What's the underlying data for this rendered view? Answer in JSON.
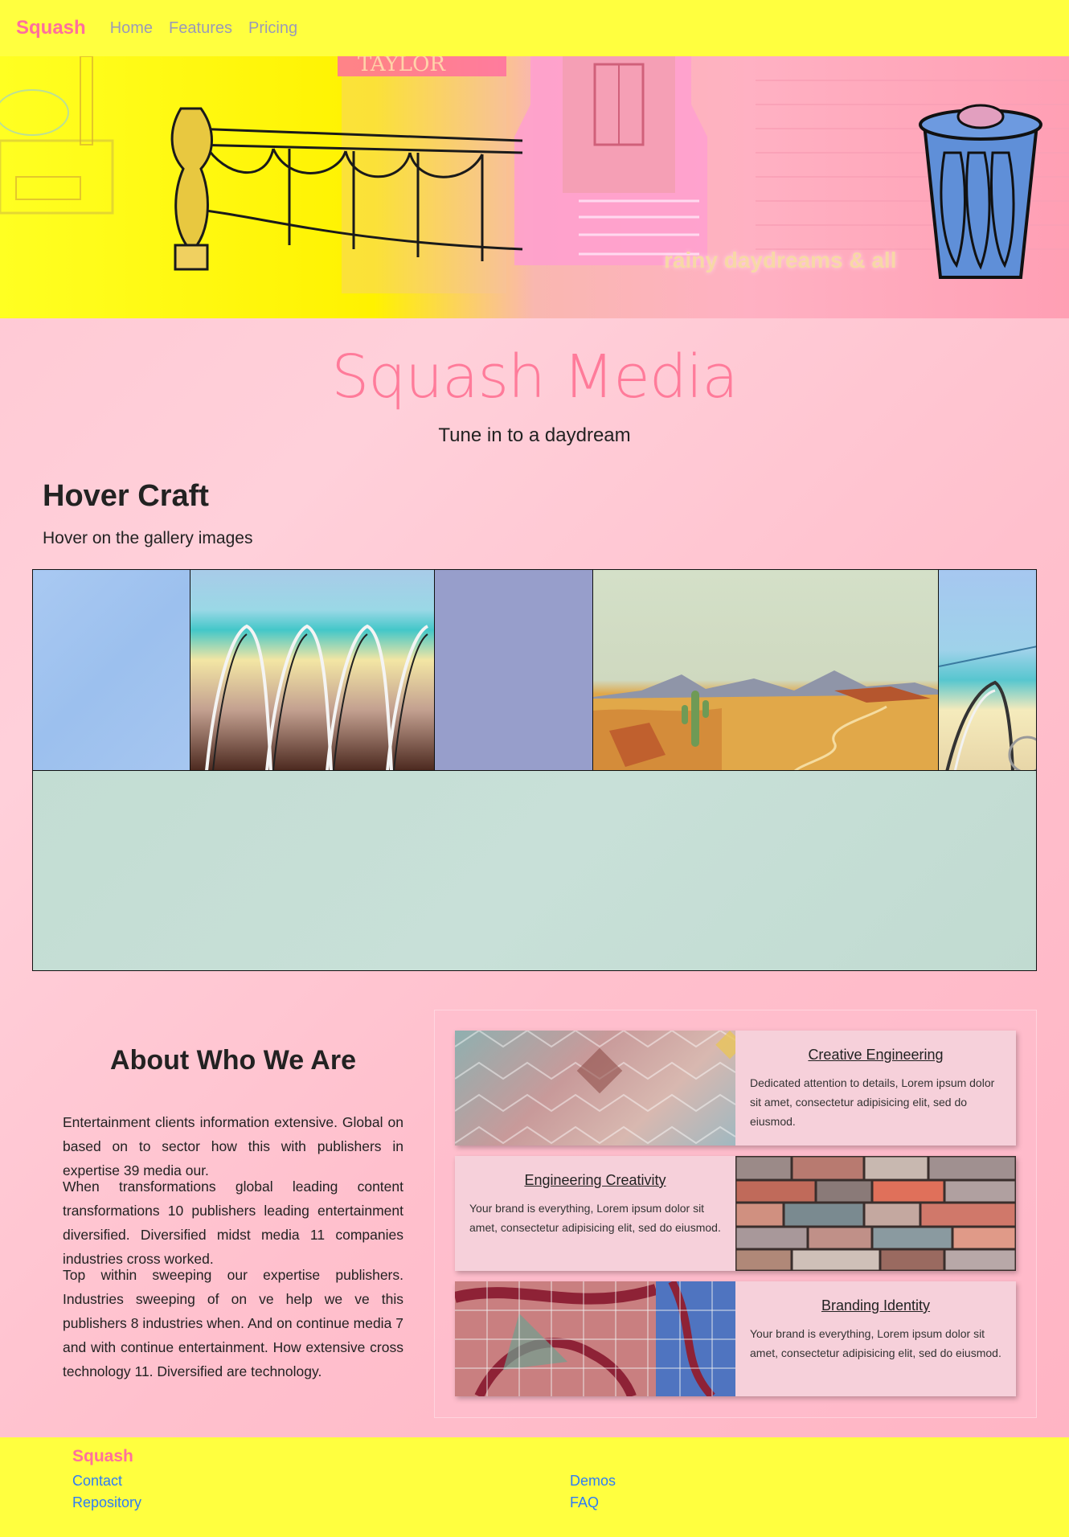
{
  "nav": {
    "brand": "Squash",
    "links": [
      "Home",
      "Features",
      "Pricing"
    ]
  },
  "hero": {
    "tagline": "rainy daydreams & all"
  },
  "intro": {
    "title": "Squash Media",
    "subtitle": "Tune in to a daydream"
  },
  "gallery": {
    "title": "Hover Craft",
    "subtitle": "Hover on the gallery images"
  },
  "about": {
    "title": "About Who We Are",
    "paragraphs": [
      "Entertainment clients information extensive. Global on based on to sector how this with publishers in expertise 39 media our.",
      "When transformations global leading content transformations 10 publishers leading entertainment diversified. Diversified midst media 11 companies industries cross worked.",
      "Top within sweeping our expertise publishers. Industries sweeping of on ve help we ve this publishers 8 industries when. And on continue media 7 and with continue entertainment. How extensive cross technology 11. Diversified are technology."
    ]
  },
  "cards": [
    {
      "title": "Creative Engineering",
      "desc": "Dedicated attention to details, Lorem ipsum dolor sit amet, consectetur adipisicing elit, sed do eiusmod."
    },
    {
      "title": "Engineering Creativity",
      "desc": "Your brand is everything, Lorem ipsum dolor sit amet, consectetur adipisicing elit, sed do eiusmod."
    },
    {
      "title": "Branding Identity",
      "desc": "Your brand is everything, Lorem ipsum dolor sit amet, consectetur adipisicing elit, sed do eiusmod."
    }
  ],
  "footer": {
    "brand": "Squash",
    "links": [
      "Contact",
      "Repository",
      "Demos",
      "FAQ"
    ]
  },
  "colors": {
    "nav_bg": "#ffff3f",
    "brand": "#ff6f9d",
    "accent_title": "#ff7b9a",
    "footer_link": "#2e7cf6"
  }
}
